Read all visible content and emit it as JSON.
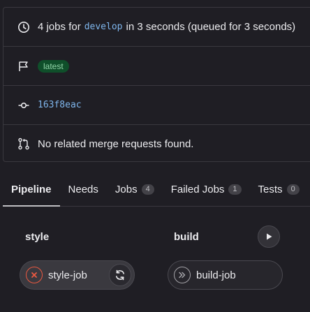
{
  "summary": {
    "jobs_prefix": "4 jobs for",
    "branch": "develop",
    "duration_text": "in 3 seconds (queued for 3 seconds)",
    "tag_badge": "latest",
    "commit_sha": "163f8eac",
    "merge_requests_text": "No related merge requests found."
  },
  "tabs": [
    {
      "label": "Pipeline",
      "count": null,
      "active": true
    },
    {
      "label": "Needs",
      "count": null
    },
    {
      "label": "Jobs",
      "count": "4"
    },
    {
      "label": "Failed Jobs",
      "count": "1"
    },
    {
      "label": "Tests",
      "count": "0"
    }
  ],
  "stages": [
    {
      "name": "style",
      "jobs": [
        {
          "name": "style-job",
          "status": "failed"
        }
      ]
    },
    {
      "name": "build",
      "jobs": [
        {
          "name": "build-job",
          "status": "skipped"
        }
      ]
    }
  ],
  "colors": {
    "background": "#1f1e24",
    "link": "#7fb6ed",
    "failed": "#ec5941",
    "badge_bg": "#0f4f2a",
    "badge_fg": "#91d4a8"
  },
  "icons": {
    "duration": "clock-icon",
    "tag": "flag-icon",
    "commit": "commit-icon",
    "merge": "merge-request-icon",
    "play": "play-icon",
    "failed": "status-failed-icon",
    "skipped": "status-skipped-icon",
    "retry": "retry-icon"
  }
}
